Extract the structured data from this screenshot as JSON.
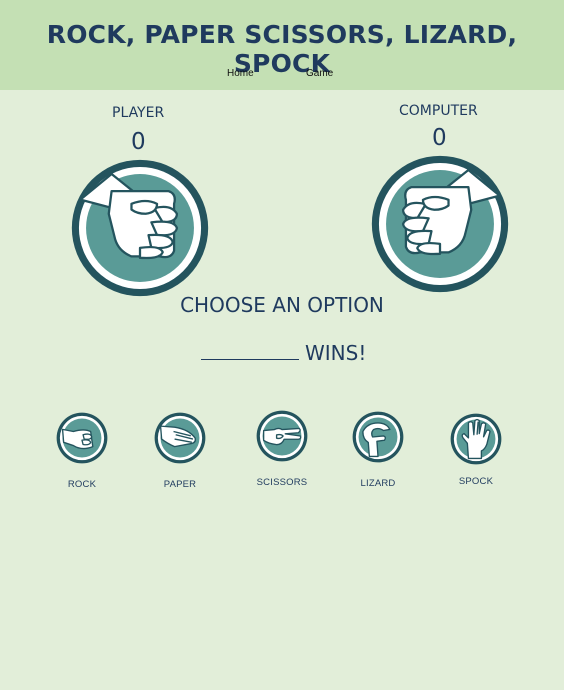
{
  "header": {
    "title": "ROCK, PAPER SCISSORS, LIZARD, SPOCK",
    "nav": [
      {
        "label": "Home"
      },
      {
        "label": "Game"
      }
    ]
  },
  "player": {
    "label": "PLAYER",
    "score": "0",
    "hand": "rock"
  },
  "computer": {
    "label": "COMPUTER",
    "score": "0",
    "hand": "rock"
  },
  "prompt": "CHOOSE AN OPTION",
  "result": {
    "text": "WINS!"
  },
  "options": [
    {
      "label": "ROCK",
      "icon": "rock-icon"
    },
    {
      "label": "PAPER",
      "icon": "paper-icon"
    },
    {
      "label": "SCISSORS",
      "icon": "scissors-icon"
    },
    {
      "label": "LIZARD",
      "icon": "lizard-icon"
    },
    {
      "label": "SPOCK",
      "icon": "spock-icon"
    }
  ],
  "colors": {
    "background": "#e2eed9",
    "header": "#c4e0b4",
    "text": "#1f3a5e",
    "ring": "#24545e",
    "icon_fill": "#5a9b97"
  }
}
